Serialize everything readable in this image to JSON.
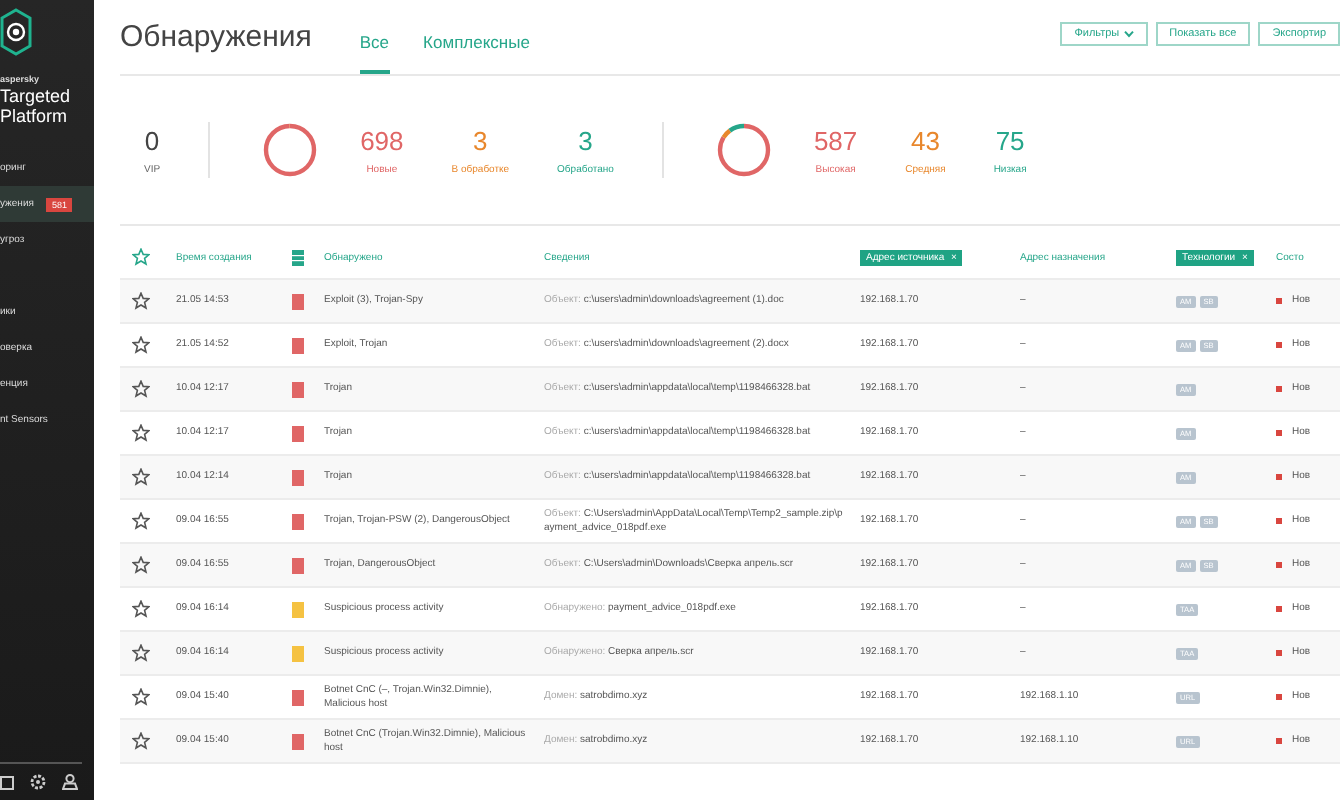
{
  "sidebar": {
    "brand": [
      "aspersky",
      "Targeted",
      "Platform"
    ],
    "items": [
      {
        "label": "оринг",
        "selected": false
      },
      {
        "label": "ужения",
        "selected": true,
        "badge": "581"
      },
      {
        "label": "угроз",
        "selected": false
      },
      {
        "label": "ики",
        "selected": false
      },
      {
        "label": "оверка",
        "selected": false
      },
      {
        "label": "енция",
        "selected": false
      },
      {
        "label": "nt Sensors",
        "selected": false
      }
    ]
  },
  "header": {
    "title": "Обнаружения",
    "tabs": [
      {
        "label": "Все",
        "selected": true
      },
      {
        "label": "Комплексные",
        "selected": false
      }
    ],
    "buttons": [
      {
        "label": "Фильтры",
        "dropdown": true
      },
      {
        "label": "Показать все",
        "dropdown": false
      },
      {
        "label": "Экспортир",
        "dropdown": false
      }
    ]
  },
  "stats": {
    "vip": {
      "value": "0",
      "label": "VIP"
    },
    "status": [
      {
        "value": "698",
        "label": "Новые",
        "color": "#e06666"
      },
      {
        "value": "3",
        "label": "В обработке",
        "color": "#e8872c"
      },
      {
        "value": "3",
        "label": "Обработано",
        "color": "#26a68a"
      }
    ],
    "severity": [
      {
        "value": "587",
        "label": "Высокая",
        "color": "#e06666"
      },
      {
        "value": "43",
        "label": "Средняя",
        "color": "#e8872c"
      },
      {
        "value": "75",
        "label": "Низкая",
        "color": "#26a68a"
      }
    ]
  },
  "table": {
    "columns": [
      {
        "kind": "star"
      },
      {
        "kind": "text",
        "label": "Время создания",
        "filter": false
      },
      {
        "kind": "severity"
      },
      {
        "kind": "text",
        "label": "Обнаружено",
        "filter": false
      },
      {
        "kind": "text",
        "label": "Сведения",
        "filter": false
      },
      {
        "kind": "text",
        "label": "Адрес источника",
        "filter": true,
        "remove": "×"
      },
      {
        "kind": "text",
        "label": "Адрес назначения",
        "filter": false
      },
      {
        "kind": "text",
        "label": "Технологии",
        "filter": true,
        "remove": "×"
      },
      {
        "kind": "text",
        "label": "Состо",
        "filter": false
      }
    ],
    "rows": [
      {
        "starred": false,
        "time": "21.05 14:53",
        "color": "#e06666",
        "detected": "Exploit (3), Trojan-Spy",
        "info_label": "Объект:",
        "info_value": "c:\\users\\admin\\downloads\\agreement (1).doc",
        "source": "192.168.1.70",
        "destination": "–",
        "tech": [
          "AM",
          "SB"
        ],
        "status": "Нов"
      },
      {
        "starred": false,
        "time": "21.05 14:52",
        "color": "#e06666",
        "detected": "Exploit, Trojan",
        "info_label": "Объект:",
        "info_value": "c:\\users\\admin\\downloads\\agreement (2).docx",
        "source": "192.168.1.70",
        "destination": "–",
        "tech": [
          "AM",
          "SB"
        ],
        "status": "Нов"
      },
      {
        "starred": false,
        "time": "10.04 12:17",
        "color": "#e06666",
        "detected": "Trojan",
        "info_label": "Объект:",
        "info_value": "c:\\users\\admin\\appdata\\local\\temp\\1198466328.bat",
        "source": "192.168.1.70",
        "destination": "–",
        "tech": [
          "AM"
        ],
        "status": "Нов"
      },
      {
        "starred": false,
        "time": "10.04 12:17",
        "color": "#e06666",
        "detected": "Trojan",
        "info_label": "Объект:",
        "info_value": "c:\\users\\admin\\appdata\\local\\temp\\1198466328.bat",
        "source": "192.168.1.70",
        "destination": "–",
        "tech": [
          "AM"
        ],
        "status": "Нов"
      },
      {
        "starred": false,
        "time": "10.04 12:14",
        "color": "#e06666",
        "detected": "Trojan",
        "info_label": "Объект:",
        "info_value": "c:\\users\\admin\\appdata\\local\\temp\\1198466328.bat",
        "source": "192.168.1.70",
        "destination": "–",
        "tech": [
          "AM"
        ],
        "status": "Нов"
      },
      {
        "starred": false,
        "time": "09.04 16:55",
        "color": "#e06666",
        "detected": "Trojan, Trojan-PSW (2), DangerousObject",
        "info_label": "Объект:",
        "info_value": "C:\\Users\\admin\\AppData\\Local\\Temp\\Temp2_sample.zip\\payment_advice_018pdf.exe",
        "source": "192.168.1.70",
        "destination": "–",
        "tech": [
          "AM",
          "SB"
        ],
        "status": "Нов"
      },
      {
        "starred": false,
        "time": "09.04 16:55",
        "color": "#e06666",
        "detected": "Trojan, DangerousObject",
        "info_label": "Объект:",
        "info_value": "C:\\Users\\admin\\Downloads\\Сверка апрель.scr",
        "source": "192.168.1.70",
        "destination": "–",
        "tech": [
          "AM",
          "SB"
        ],
        "status": "Нов"
      },
      {
        "starred": false,
        "time": "09.04 16:14",
        "color": "#f5c242",
        "detected": "Suspicious process activity",
        "info_label": "Обнаружено:",
        "info_value": "payment_advice_018pdf.exe",
        "source": "192.168.1.70",
        "destination": "–",
        "tech": [
          "TAA"
        ],
        "status": "Нов"
      },
      {
        "starred": false,
        "time": "09.04 16:14",
        "color": "#f5c242",
        "detected": "Suspicious process activity",
        "info_label": "Обнаружено:",
        "info_value": "Сверка апрель.scr",
        "source": "192.168.1.70",
        "destination": "–",
        "tech": [
          "TAA"
        ],
        "status": "Нов"
      },
      {
        "starred": false,
        "time": "09.04 15:40",
        "color": "#e06666",
        "detected": "Botnet CnC (–, Trojan.Win32.Dimnie), Malicious host",
        "info_label": "Домен:",
        "info_value": "satrobdimo.xyz",
        "source": "192.168.1.70",
        "destination": "192.168.1.10",
        "tech": [
          "URL"
        ],
        "status": "Нов"
      },
      {
        "starred": false,
        "time": "09.04 15:40",
        "color": "#e06666",
        "detected": "Botnet CnC (Trojan.Win32.Dimnie), Malicious host",
        "info_label": "Домен:",
        "info_value": "satrobdimo.xyz",
        "source": "192.168.1.70",
        "destination": "192.168.1.10",
        "tech": [
          "URL"
        ],
        "status": "Нов"
      }
    ]
  }
}
